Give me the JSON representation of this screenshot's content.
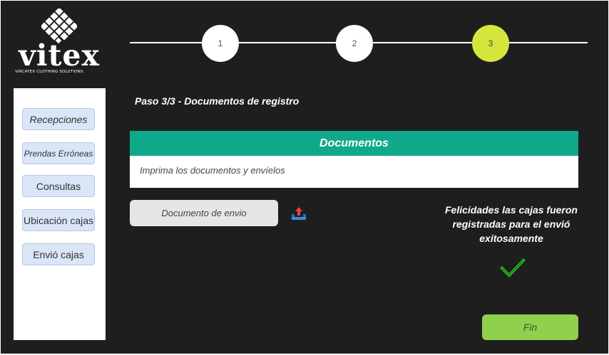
{
  "logo": {
    "word": "vitex",
    "tagline": "VIRCATEX CLOTHING SOLUTIONS"
  },
  "stepper": {
    "steps": [
      "1",
      "2",
      "3"
    ],
    "active_step": "3"
  },
  "sidebar": {
    "items": [
      {
        "label": "Recepciones"
      },
      {
        "label": "Prendas Erróneas"
      },
      {
        "label": "Consultas"
      },
      {
        "label": "Ubicación cajas"
      },
      {
        "label": "Envió cajas"
      }
    ]
  },
  "main": {
    "step_title": "Paso 3/3 - Documentos de registro",
    "documents": {
      "header": "Documentos",
      "instruction": "Imprima los documentos y envíelos"
    },
    "document_button": "Documento de envio",
    "success_message": "Felicidades las cajas fueron registradas para el envió exitosamente",
    "finish_button": "Fin"
  },
  "colors": {
    "background": "#1e1e1e",
    "accent_teal": "#10a88a",
    "active_step": "#d4e63c",
    "finish_green": "#8fd14f",
    "sidebar_button": "#dae6f7",
    "check_green": "#22c022"
  },
  "icons": {
    "upload": "upload-icon",
    "check": "check-icon",
    "logo_mark": "woven-diamond-icon"
  }
}
